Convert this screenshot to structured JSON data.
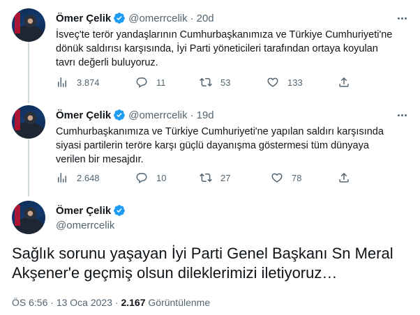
{
  "colors": {
    "verified": "#1d9bf0",
    "text": "#0f1419",
    "muted": "#536471",
    "line": "#cfd9de"
  },
  "tweets": [
    {
      "name": "Ömer Çelik",
      "handle": "@omerrcelik",
      "separator": "·",
      "time": "20d",
      "text": "İsveç'te terör yandaşlarının Cumhurbaşkanımıza ve Türkiye Cumhuriyeti'ne dönük saldırısı karşısında, İyi Parti yöneticileri tarafından ortaya koyulan tavrı değerli buluyoruz.",
      "views": "3.874",
      "replies": "11",
      "retweets": "53",
      "likes": "133"
    },
    {
      "name": "Ömer Çelik",
      "handle": "@omerrcelik",
      "separator": "·",
      "time": "19d",
      "text": "Cumhurbaşkanımıza ve Türkiye Cumhuriyeti'ne yapılan saldırı karşısında siyasi partilerin teröre karşı güçlü dayanışma göstermesi tüm dünyaya verilen bir mesajdır.",
      "views": "2.648",
      "replies": "10",
      "retweets": "27",
      "likes": "78"
    }
  ],
  "main": {
    "name": "Ömer Çelik",
    "handle": "@omerrcelik",
    "text": "Sağlık sorunu yaşayan İyi Parti Genel Başkanı Sn Meral Akşener'e geçmiş olsun dileklerimizi iletiyoruz…",
    "time": "ÖS 6:56",
    "separator": "·",
    "date": "13 Oca 2023",
    "views_count": "2.167",
    "views_label": "Görüntülenme"
  },
  "icons": [
    "verified-badge-icon",
    "more-icon",
    "views-icon",
    "reply-icon",
    "retweet-icon",
    "like-icon",
    "share-icon"
  ]
}
